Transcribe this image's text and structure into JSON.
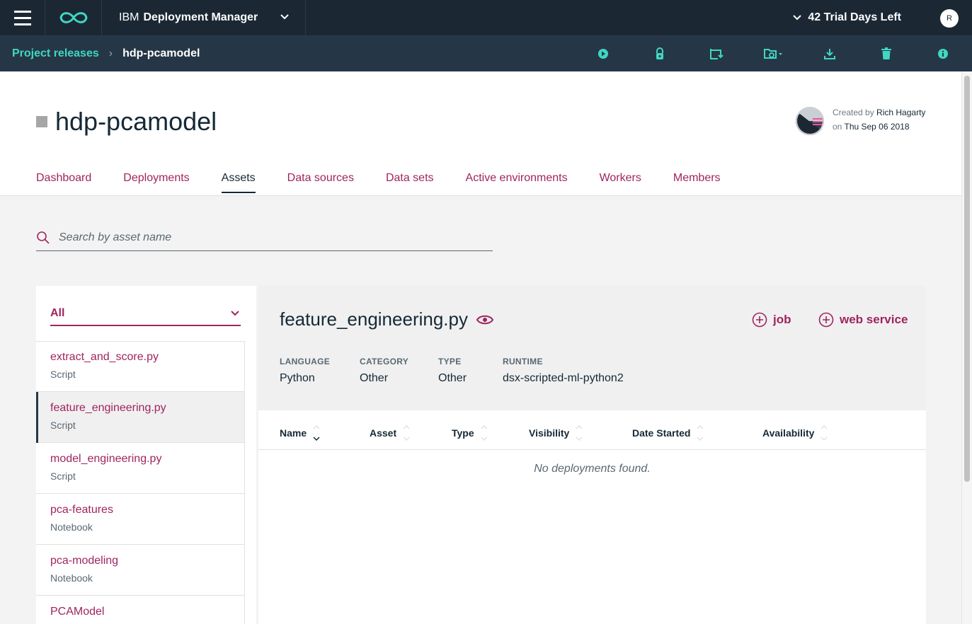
{
  "topbar": {
    "product_prefix": "IBM",
    "product_name": "Deployment Manager",
    "trial": "42 Trial Days Left",
    "user_initial": "R"
  },
  "breadcrumb": {
    "parent": "Project releases",
    "current": "hdp-pcamodel"
  },
  "toolbar_icons": [
    "play-icon",
    "lock-icon",
    "redeploy-icon",
    "settings-folder-icon",
    "download-icon",
    "delete-icon",
    "info-icon"
  ],
  "project": {
    "title": "hdp-pcamodel",
    "created_by_label": "Created by",
    "created_by": "Rich Hagarty",
    "created_on_label": "on",
    "created_on": "Thu Sep 06 2018"
  },
  "tabs": [
    "Dashboard",
    "Deployments",
    "Assets",
    "Data sources",
    "Data sets",
    "Active environments",
    "Workers",
    "Members"
  ],
  "active_tab": "Assets",
  "search": {
    "placeholder": "Search by asset name"
  },
  "filter": {
    "selected": "All"
  },
  "assets": [
    {
      "name": "extract_and_score.py",
      "type": "Script"
    },
    {
      "name": "feature_engineering.py",
      "type": "Script"
    },
    {
      "name": "model_engineering.py",
      "type": "Script"
    },
    {
      "name": "pca-features",
      "type": "Notebook"
    },
    {
      "name": "pca-modeling",
      "type": "Notebook"
    },
    {
      "name": "PCAModel",
      "type": ""
    }
  ],
  "selected_asset_index": 1,
  "detail": {
    "title": "feature_engineering.py",
    "actions": {
      "job": "job",
      "web_service": "web service"
    },
    "meta": [
      {
        "label": "LANGUAGE",
        "value": "Python"
      },
      {
        "label": "CATEGORY",
        "value": "Other"
      },
      {
        "label": "TYPE",
        "value": "Other"
      },
      {
        "label": "RUNTIME",
        "value": "dsx-scripted-ml-python2"
      }
    ],
    "columns": [
      "Name",
      "Asset",
      "Type",
      "Visibility",
      "Date Started",
      "Availability"
    ],
    "empty_message": "No deployments found."
  },
  "colors": {
    "topbar": "#1b2834",
    "crumbbar": "#253746",
    "accent_teal": "#41d6c3",
    "accent_magenta": "#a0245e"
  }
}
